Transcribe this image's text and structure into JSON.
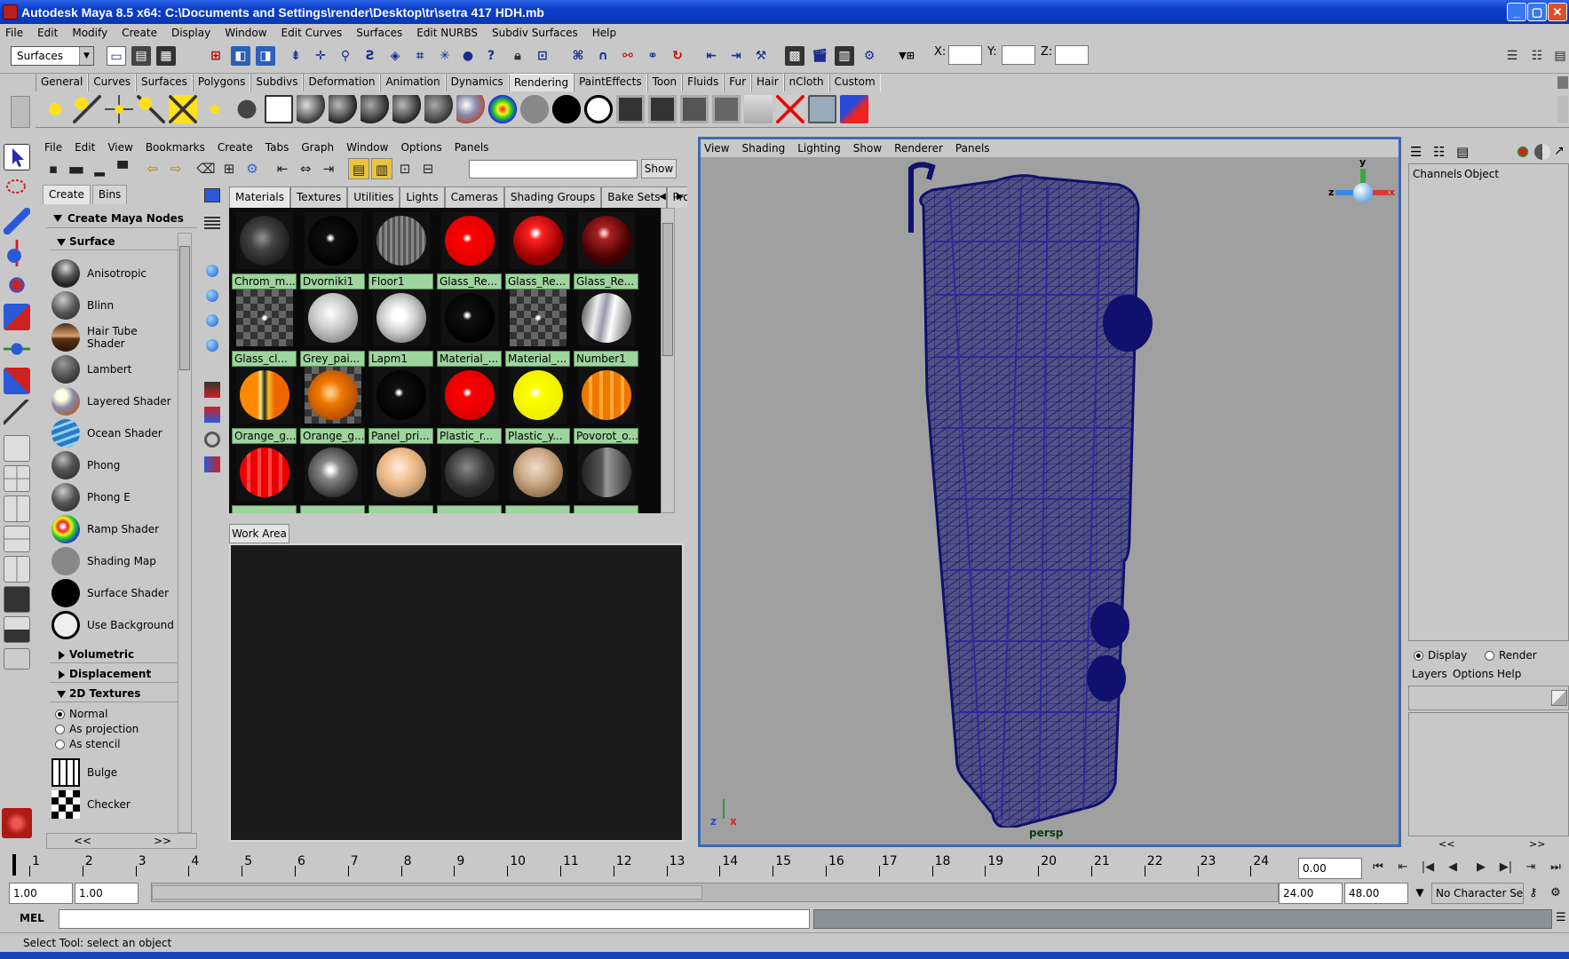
{
  "window": {
    "title": "Autodesk Maya 8.5 x64: C:\\Documents and Settings\\render\\Desktop\\tr\\setra 417 HDH.mb",
    "min": "_",
    "max": "▢",
    "close": "✕"
  },
  "main_menu": [
    "File",
    "Edit",
    "Modify",
    "Create",
    "Display",
    "Window",
    "Edit Curves",
    "Surfaces",
    "Edit NURBS",
    "Subdiv Surfaces",
    "Help"
  ],
  "status_line": {
    "mode": "Surfaces",
    "x_label": "X:",
    "y_label": "Y:",
    "z_label": "Z:"
  },
  "shelf_tabs": [
    "General",
    "Curves",
    "Surfaces",
    "Polygons",
    "Subdivs",
    "Deformation",
    "Animation",
    "Dynamics",
    "Rendering",
    "PaintEffects",
    "Toon",
    "Fluids",
    "Fur",
    "Hair",
    "nCloth",
    "Custom"
  ],
  "shelf_active": "Rendering",
  "hypershade": {
    "menu": [
      "File",
      "Edit",
      "View",
      "Bookmarks",
      "Create",
      "Tabs",
      "Graph",
      "Window",
      "Options",
      "Panels"
    ],
    "show_label": "Show",
    "create_tabs": [
      "Create",
      "Bins"
    ],
    "create_maya_nodes": "Create Maya Nodes",
    "surface_section": "Surface",
    "surface_nodes": [
      {
        "label": "Anisotropic",
        "icon": "anisotropic-shader-icon"
      },
      {
        "label": "Blinn",
        "icon": "blinn-shader-icon"
      },
      {
        "label": "Hair Tube Shader",
        "icon": "hair-tube-shader-icon"
      },
      {
        "label": "Lambert",
        "icon": "lambert-shader-icon"
      },
      {
        "label": "Layered Shader",
        "icon": "layered-shader-icon"
      },
      {
        "label": "Ocean Shader",
        "icon": "ocean-shader-icon"
      },
      {
        "label": "Phong",
        "icon": "phong-shader-icon"
      },
      {
        "label": "Phong E",
        "icon": "phong-e-shader-icon"
      },
      {
        "label": "Ramp Shader",
        "icon": "ramp-shader-icon"
      },
      {
        "label": "Shading Map",
        "icon": "shading-map-icon"
      },
      {
        "label": "Surface Shader",
        "icon": "surface-shader-icon"
      },
      {
        "label": "Use Background",
        "icon": "use-background-icon"
      }
    ],
    "volumetric_section": "Volumetric",
    "displacement_section": "Displacement",
    "textures_section": "2D Textures",
    "texture_modes": [
      "Normal",
      "As projection",
      "As stencil"
    ],
    "texture_nodes": [
      "Bulge",
      "Checker"
    ],
    "scroll_left": "<<",
    "scroll_right": ">>",
    "mat_tabs": [
      "Materials",
      "Textures",
      "Utilities",
      "Lights",
      "Cameras",
      "Shading Groups",
      "Bake Sets",
      "Projects"
    ],
    "materials": [
      "Chrom_m...",
      "Dvorniki1",
      "Floor1",
      "Glass_Re...",
      "Glass_Re...",
      "Glass_Re...",
      "Glass_cl...",
      "Grey_pai...",
      "Lapm1",
      "Material_...",
      "Material_...",
      "Number1",
      "Orange_g...",
      "Orange_g...",
      "Panel_pri...",
      "Plastic_r...",
      "Plastic_y...",
      "Povorot_o...",
      "",
      "",
      "",
      "",
      "",
      ""
    ],
    "work_area_tab": "Work Area"
  },
  "viewport": {
    "menu": [
      "View",
      "Shading",
      "Lighting",
      "Show",
      "Renderer",
      "Panels"
    ],
    "camera_label": "persp",
    "gizmo_y": "y",
    "gizmo_z": "z",
    "gizmo_x": "x"
  },
  "channel_box": {
    "tabs": [
      "Channels",
      "Object"
    ],
    "layer_modes": [
      "Display",
      "Render"
    ],
    "layer_menu": [
      "Layers",
      "Options",
      "Help"
    ],
    "scroll_left": "<<",
    "scroll_right": ">>"
  },
  "timeline": {
    "ticks": [
      "1",
      "2",
      "3",
      "4",
      "5",
      "6",
      "7",
      "8",
      "9",
      "10",
      "11",
      "12",
      "13",
      "14",
      "15",
      "16",
      "17",
      "18",
      "19",
      "20",
      "21",
      "22",
      "23",
      "24"
    ],
    "current_time": "0.00",
    "start": "1.00",
    "playback_start": "1.00",
    "playback_end": "24.00",
    "end": "48.00",
    "char_set": "No Character Set"
  },
  "command_line": {
    "label": "MEL"
  },
  "help_line": "Select Tool: select an object",
  "colors": {
    "title_bar": "#0a3cc8",
    "viewport_bg": "#a0a0a0",
    "wireframe": "#10106e",
    "material_label": "#9ed49e"
  }
}
